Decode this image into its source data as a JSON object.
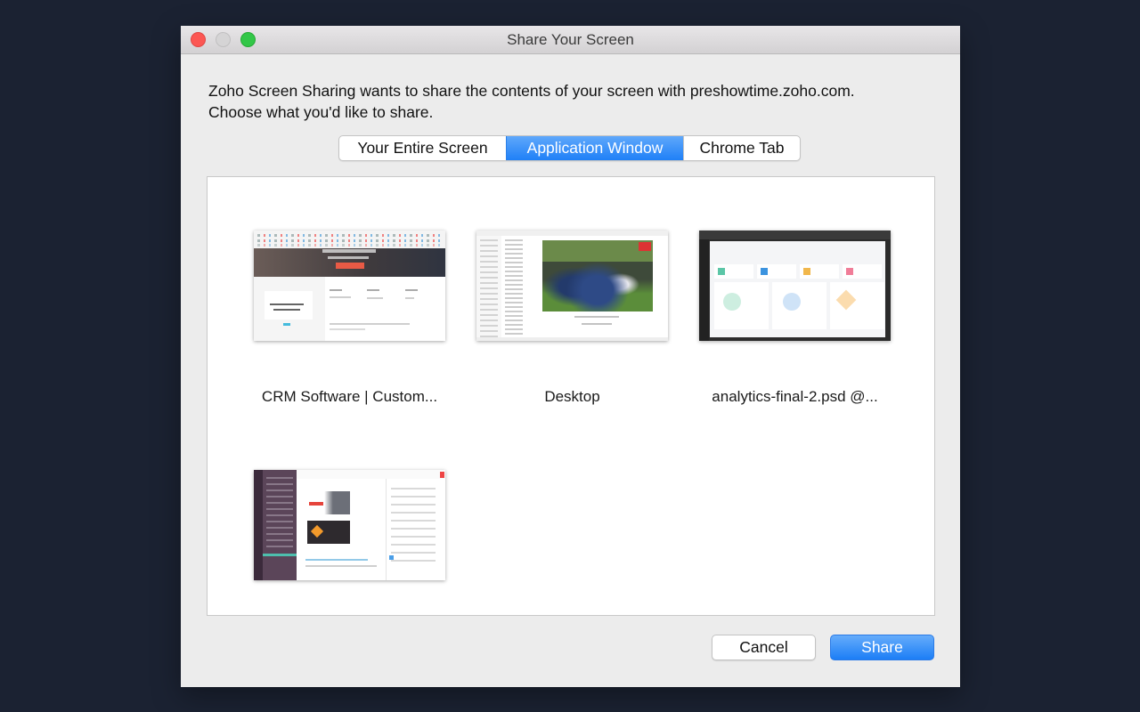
{
  "window": {
    "title": "Share Your Screen",
    "traffic_lights": [
      "close",
      "minimize",
      "zoom"
    ]
  },
  "prompt": {
    "line1": "Zoho Screen Sharing wants to share the contents of your screen with preshowtime.zoho.com.",
    "line2": "Choose what you'd like to share."
  },
  "tabs": [
    {
      "label": "Your Entire Screen",
      "active": false
    },
    {
      "label": "Application Window",
      "active": true
    },
    {
      "label": "Chrome Tab",
      "active": false
    }
  ],
  "windows": [
    {
      "label": "CRM Software | Custom...",
      "thumbnail": "crm-website-preview"
    },
    {
      "label": "Desktop",
      "thumbnail": "desktop-photo-preview"
    },
    {
      "label": "analytics-final-2.psd @...",
      "thumbnail": "photoshop-dashboard-preview"
    },
    {
      "label": "",
      "thumbnail": "chat-app-preview"
    }
  ],
  "buttons": {
    "cancel": "Cancel",
    "share": "Share"
  },
  "colors": {
    "accent": "#1f80f7",
    "background": "#1b2232",
    "window": "#ececec"
  }
}
